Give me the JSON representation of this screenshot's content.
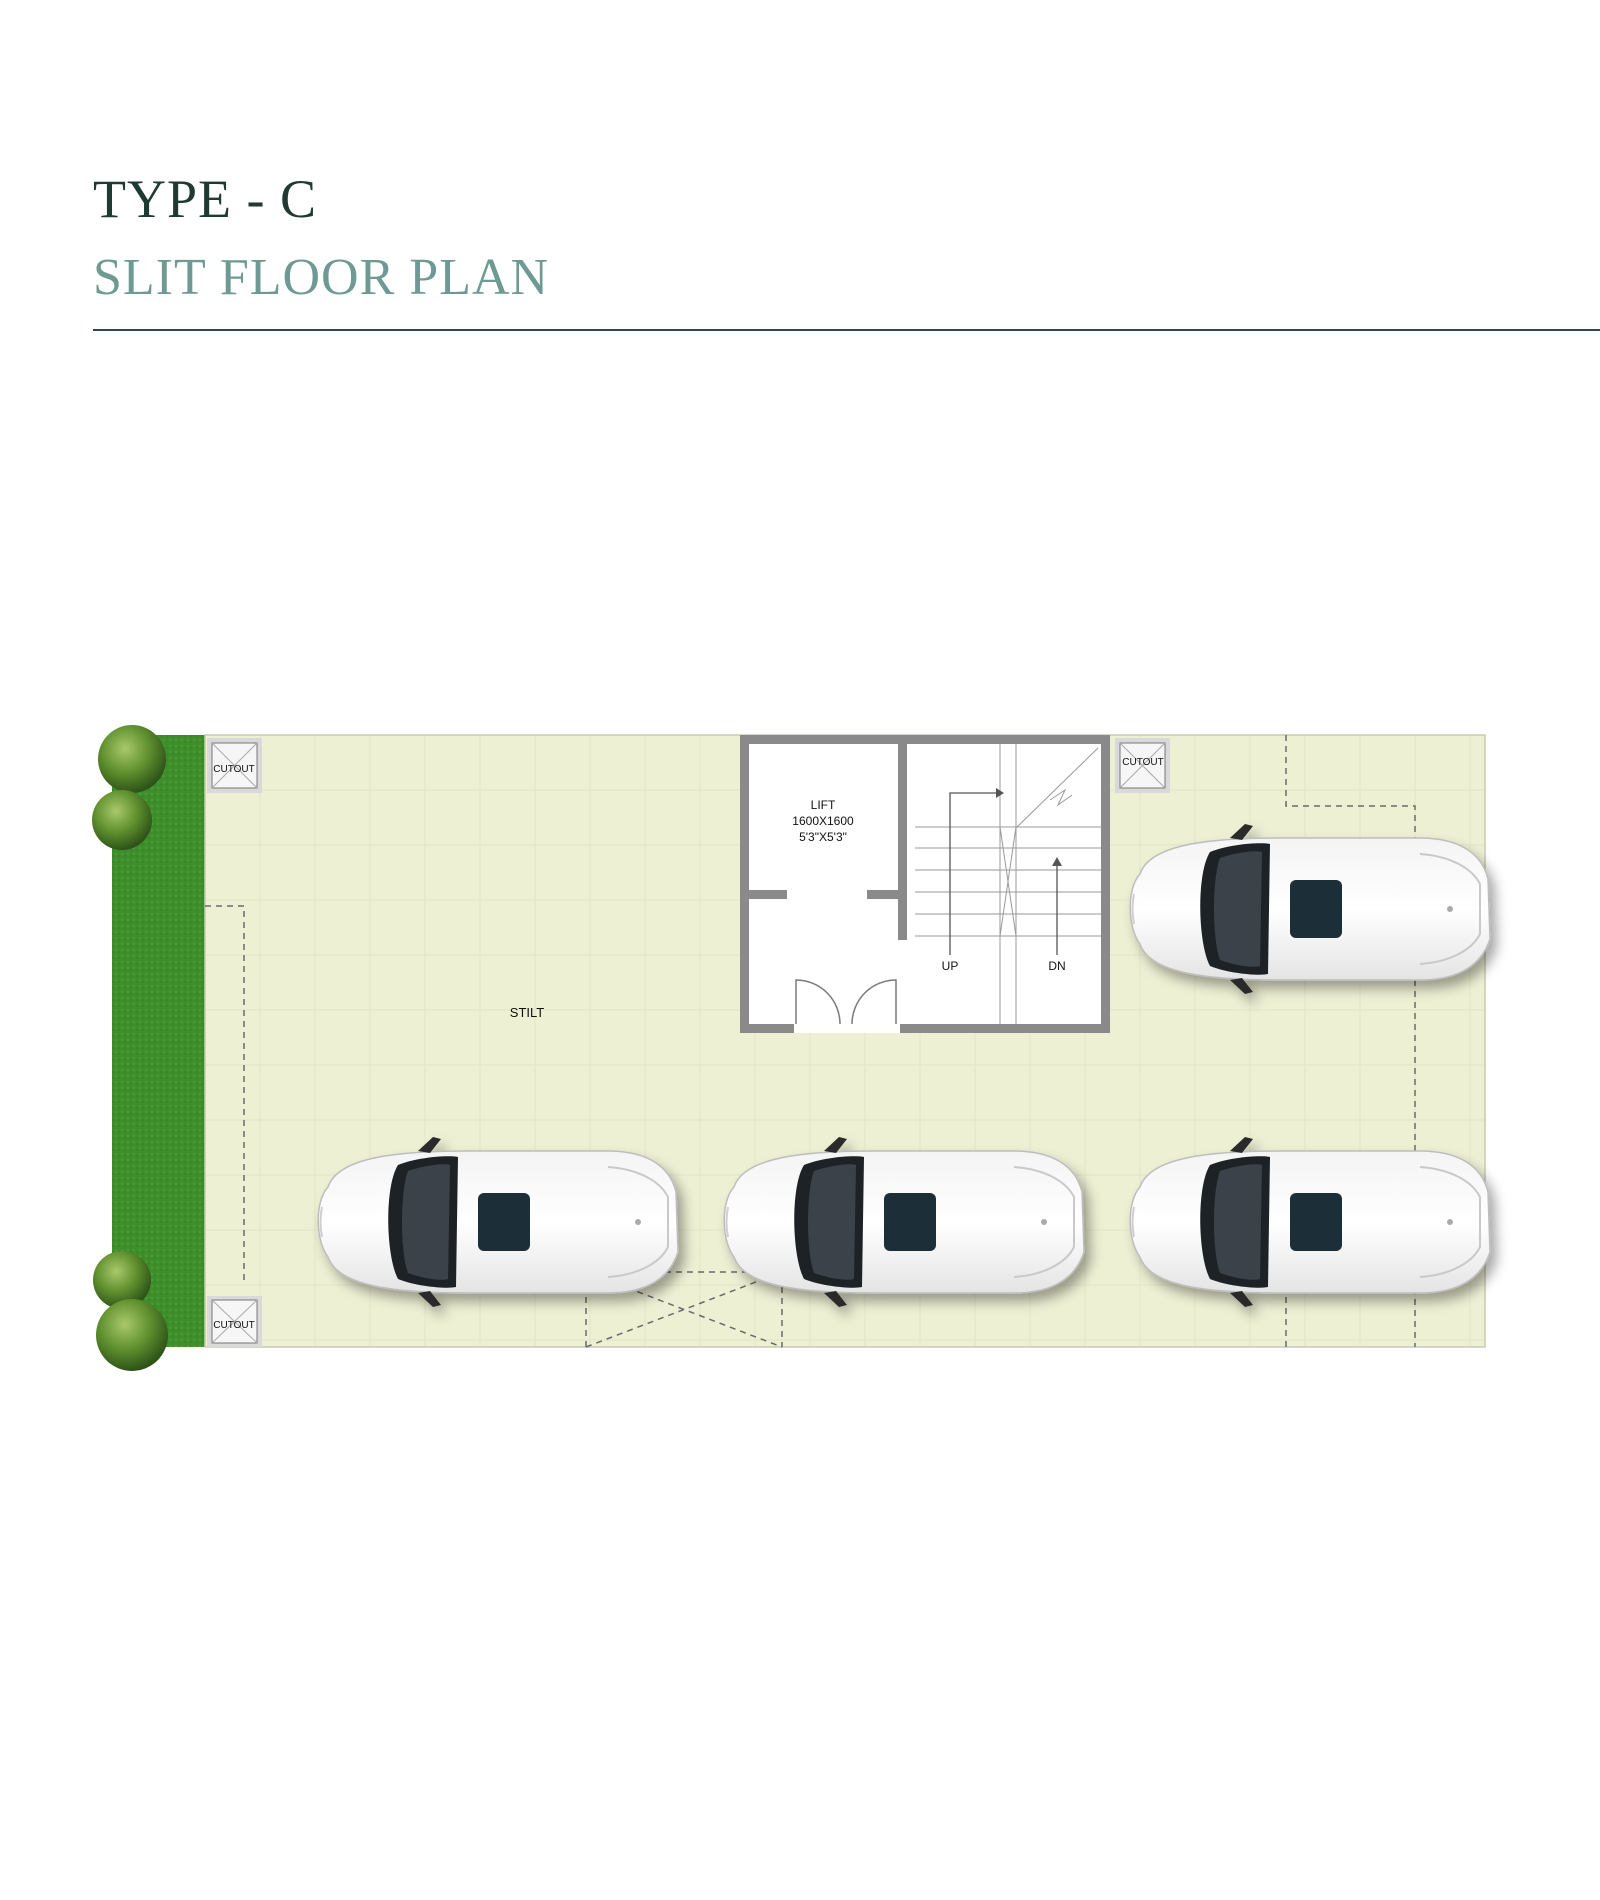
{
  "header": {
    "title": "TYPE - C",
    "subtitle": "SLIT FLOOR PLAN"
  },
  "plan": {
    "area_label": "STILT",
    "lift": {
      "name": "LIFT",
      "size_mm": "1600X1600",
      "size_ft": "5'3\"X5'3\""
    },
    "stair_up_label": "UP",
    "stair_down_label": "DN",
    "cutout_label": "CUTOUT",
    "parking_slots": 4
  },
  "colors": {
    "title": "#1f3a33",
    "subtitle": "#6e9a93",
    "floor": "#eef0d4",
    "lawn": "#3e8f2c",
    "wall": "#8a8a8a"
  }
}
